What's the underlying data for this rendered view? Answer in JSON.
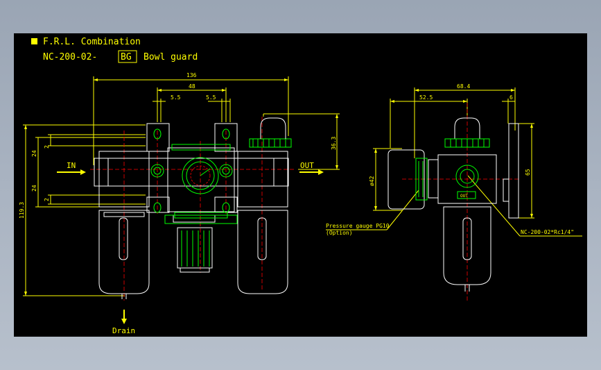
{
  "title": {
    "line1": "F.R.L. Combination",
    "model_prefix": "NC-200-02-",
    "model_boxed": "BG",
    "model_suffix": "Bowl guard"
  },
  "labels": {
    "in": "IN",
    "out": "OUT",
    "drain": "Drain",
    "gauge_l1": "Pressure gauge PG10",
    "gauge_l2": "(Option)",
    "port": "NC-200-02*Rc1/4\"",
    "out_small": "OUT"
  },
  "dimensions": {
    "front_width": "136",
    "front_48": "48",
    "front_5_5_left": "5.5",
    "front_5_5_right": "5.5",
    "front_36_3": "36.3",
    "front_119_3": "119.3",
    "front_24_top": "24",
    "front_24_bottom": "24",
    "front_2_top": "2",
    "front_2_bottom": "2",
    "side_68_4": "68.4",
    "side_52_5": "52.5",
    "side_6": "6",
    "side_65": "65",
    "side_phi42": "ø42"
  },
  "colors": {
    "background": "#000000",
    "dimension": "#ffff00",
    "body": "#ffffff",
    "center": "#ff0000",
    "fitting": "#00ff00",
    "text": "#ffff00"
  }
}
